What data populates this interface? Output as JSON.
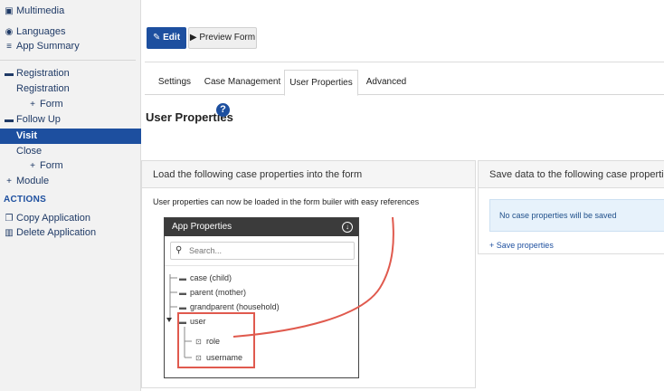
{
  "sidebar": {
    "items": [
      {
        "icon": "image-icon",
        "glyph": "▣",
        "label": "Multimedia"
      },
      {
        "icon": "globe-icon",
        "glyph": "◉",
        "label": "Languages"
      },
      {
        "icon": "list-icon",
        "glyph": "≡",
        "label": "App Summary"
      },
      {
        "icon": "folder-icon",
        "glyph": "▬",
        "label": "Registration"
      },
      {
        "label": "Registration"
      },
      {
        "icon": "plus-icon",
        "glyph": "+",
        "label": "Form"
      },
      {
        "icon": "folder-icon",
        "glyph": "▬",
        "label": "Follow Up"
      },
      {
        "label": "Visit"
      },
      {
        "label": "Close"
      },
      {
        "icon": "plus-icon",
        "glyph": "+",
        "label": "Form"
      },
      {
        "icon": "plus-icon",
        "glyph": "+",
        "label": "Module"
      }
    ],
    "actions_heading": "ACTIONS",
    "actions": [
      {
        "icon": "copy-icon",
        "glyph": "❐",
        "label": "Copy Application"
      },
      {
        "icon": "trash-icon",
        "glyph": "▥",
        "label": "Delete Application"
      }
    ]
  },
  "toolbar": {
    "edit_label": "Edit",
    "preview_label": "Preview Form"
  },
  "tabs": [
    {
      "label": "Settings"
    },
    {
      "label": "Case Management"
    },
    {
      "label": "User Properties"
    },
    {
      "label": "Advanced"
    }
  ],
  "page_title": "User Properties",
  "load_panel": {
    "title": "Load the following case properties into the form",
    "description": "User properties can now be loaded in the form builer with easy references",
    "app_properties": {
      "title": "App Properties",
      "search_placeholder": "Search...",
      "tree": [
        {
          "label": "case (child)",
          "icon": "folder-icon"
        },
        {
          "label": "parent (mother)",
          "icon": "folder-icon"
        },
        {
          "label": "grandparent (household)",
          "icon": "folder-icon"
        },
        {
          "label": "user",
          "icon": "folder-open-icon"
        },
        {
          "label": "role",
          "icon": "property-icon"
        },
        {
          "label": "username",
          "icon": "property-icon"
        }
      ]
    }
  },
  "save_panel": {
    "title": "Save data to the following case properties",
    "notice": "No case properties will be saved",
    "save_link": "Save properties"
  },
  "colors": {
    "accent": "#1d4f9f",
    "highlight": "#e05a4e"
  }
}
